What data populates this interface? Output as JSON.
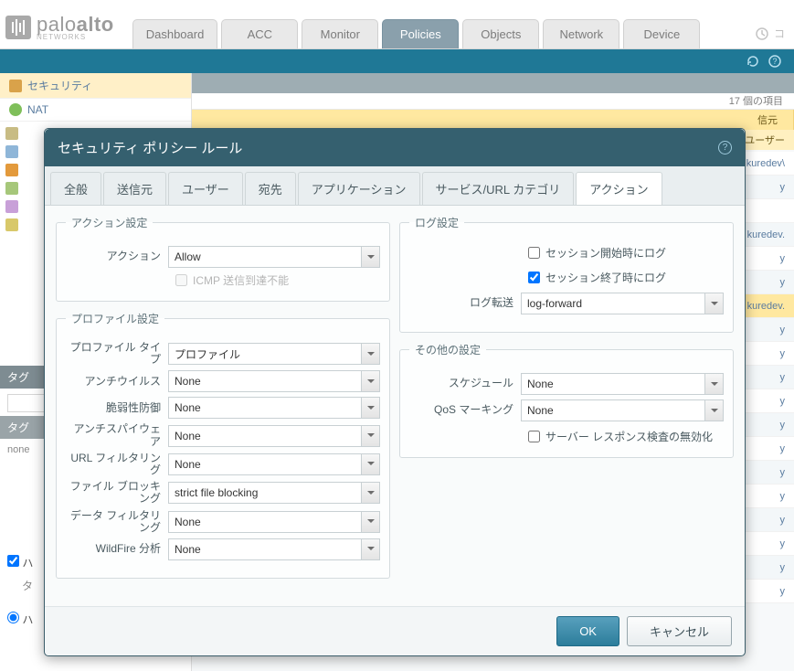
{
  "logo": {
    "brand_a": "palo",
    "brand_b": "alto",
    "sub": "NETWORKS"
  },
  "main_tabs": [
    "Dashboard",
    "ACC",
    "Monitor",
    "Policies",
    "Objects",
    "Network",
    "Device"
  ],
  "main_tabs_active": 3,
  "commit_label": "コ",
  "sidebar": {
    "security": "セキュリティ",
    "nat": "NAT"
  },
  "content": {
    "item_count": "17 個の項目",
    "col_source": "信元",
    "col_user": "ユーザー",
    "bg_user_1": "kuredev\\",
    "bg_user_2": "kuredev.",
    "bg_user_3": "kuredev.",
    "any": "y"
  },
  "tag_panel": {
    "header": "タグ",
    "header2": "タグ",
    "none": "none"
  },
  "modal": {
    "title": "セキュリティ ポリシー ルール",
    "tabs": [
      "全般",
      "送信元",
      "ユーザー",
      "宛先",
      "アプリケーション",
      "サービス/URL カテゴリ",
      "アクション"
    ],
    "tabs_active": 6,
    "action_settings": {
      "legend": "アクション設定",
      "label_action": "アクション",
      "value_action": "Allow",
      "label_icmp": "ICMP 送信到達不能"
    },
    "profile_settings": {
      "legend": "プロファイル設定",
      "label_type": "プロファイル タイプ",
      "value_type": "プロファイル",
      "label_av": "アンチウイルス",
      "value_av": "None",
      "label_vuln": "脆弱性防御",
      "value_vuln": "None",
      "label_spy": "アンチスパイウェア",
      "value_spy": "None",
      "label_url": "URL フィルタリング",
      "value_url": "None",
      "label_file": "ファイル ブロッキング",
      "value_file": "strict file blocking",
      "label_data": "データ フィルタリング",
      "value_data": "None",
      "label_wf": "WildFire 分析",
      "value_wf": "None"
    },
    "log_settings": {
      "legend": "ログ設定",
      "label_start": "セッション開始時にログ",
      "label_end": "セッション終了時にログ",
      "label_fw": "ログ転送",
      "value_fw": "log-forward"
    },
    "other_settings": {
      "legend": "その他の設定",
      "label_sched": "スケジュール",
      "value_sched": "None",
      "label_qos": "QoS マーキング",
      "value_qos": "None",
      "label_dsri": "サーバー レスポンス検査の無効化"
    },
    "buttons": {
      "ok": "OK",
      "cancel": "キャンセル"
    }
  }
}
